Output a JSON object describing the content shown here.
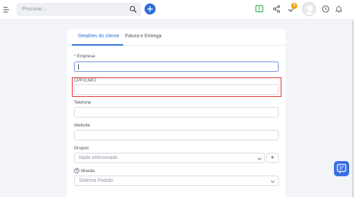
{
  "topbar": {
    "search_placeholder": "Procurar...",
    "notification_badge": "3",
    "icons": [
      "menu-icon",
      "search-icon",
      "plus-icon",
      "feedback-icon",
      "share-icon",
      "check-icon",
      "avatar",
      "clock-icon",
      "bell-icon"
    ]
  },
  "tabs": [
    {
      "label": "Detalhes do cliente",
      "active": true
    },
    {
      "label": "Fatura e Entrega",
      "active": false
    }
  ],
  "form": {
    "empresa": {
      "label": "Empresa",
      "required_mark": "*",
      "value": ""
    },
    "cpf": {
      "label": "CPF/CNPJ",
      "value": ""
    },
    "telefone": {
      "label": "Telefone",
      "value": ""
    },
    "website": {
      "label": "Website",
      "value": ""
    },
    "grupos": {
      "label": "Grupos",
      "value": "Nada selecionado",
      "add_label": "+"
    },
    "moeda": {
      "label": "Moeda",
      "value": "Sistema Padrão"
    }
  },
  "colors": {
    "accent": "#2d6fd8",
    "highlight": "#e02a2a",
    "badge": "#f2a20c",
    "feedback_green": "#2faa4a"
  }
}
